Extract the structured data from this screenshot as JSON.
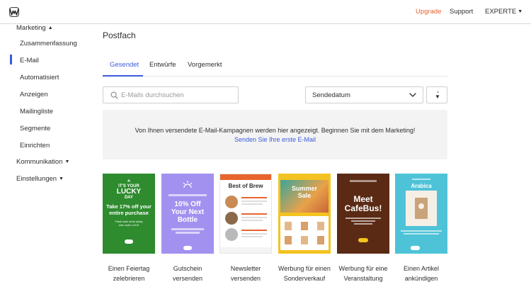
{
  "header": {
    "upgrade_label": "Upgrade",
    "support_label": "Support",
    "account_label": "EXPERTE"
  },
  "sidebar": {
    "marketing_label": "Marketing",
    "items": [
      {
        "label": "Zusammenfassung"
      },
      {
        "label": "E-Mail"
      },
      {
        "label": "Automatisiert"
      },
      {
        "label": "Anzeigen"
      },
      {
        "label": "Mailingliste"
      },
      {
        "label": "Segmente"
      },
      {
        "label": "Einrichten"
      }
    ],
    "kommunikation_label": "Kommunikation",
    "einstellungen_label": "Einstellungen"
  },
  "main": {
    "title": "Postfach",
    "tabs": [
      {
        "label": "Gesendet"
      },
      {
        "label": "Entwürfe"
      },
      {
        "label": "Vorgemerkt"
      }
    ],
    "search": {
      "placeholder": "E-Mails durchsuchen",
      "value": ""
    },
    "sort": {
      "selected": "Sendedatum"
    },
    "empty_state": {
      "message": "Von Ihnen versendete E-Mail-Kampagnen werden hier angezeigt. Beginnen Sie mit dem Marketing!",
      "link": "Senden Sie Ihre erste E-Mail"
    }
  },
  "templates": [
    {
      "label_line1": "Einen Feiertag",
      "label_line2": "zelebrieren",
      "thumb": {
        "l1": "IT'S YOUR",
        "l2": "LUCKY",
        "l3": "DAY",
        "offer": "Take 17% off your entire purchase",
        "sub1": "Flash sale ends today",
        "sub2": "Use code LUCK"
      }
    },
    {
      "label_line1": "Gutschein",
      "label_line2": "versenden",
      "thumb": {
        "offer1": "10% Off",
        "offer2": "Your Next",
        "offer3": "Bottle"
      }
    },
    {
      "label_line1": "Newsletter",
      "label_line2": "versenden",
      "thumb": {
        "title": "Best of Brew"
      }
    },
    {
      "label_line1": "Werbung für einen",
      "label_line2": "Sonderverkauf",
      "thumb": {
        "l1": "Summer",
        "l2": "Sale"
      }
    },
    {
      "label_line1": "Werbung für eine",
      "label_line2": "Veranstaltung",
      "thumb": {
        "l1": "Meet",
        "l2": "CafeBus!"
      }
    },
    {
      "label_line1": "Einen Artikel",
      "label_line2": "ankündigen",
      "thumb": {
        "title": "Arabica"
      }
    }
  ],
  "colors": {
    "accent": "#3b5bdb",
    "upgrade": "#e8642c"
  }
}
